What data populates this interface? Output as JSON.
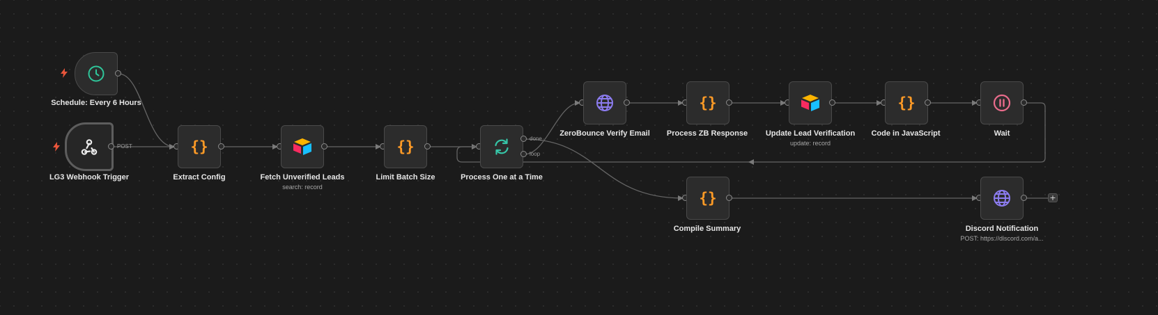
{
  "nodes": {
    "schedule": {
      "label": "Schedule: Every 6 Hours"
    },
    "webhook": {
      "label": "LG3 Webhook Trigger"
    },
    "extract_config": {
      "label": "Extract Config"
    },
    "fetch_leads": {
      "label": "Fetch Unverified Leads",
      "sublabel": "search: record"
    },
    "limit_batch": {
      "label": "Limit Batch Size"
    },
    "process_one": {
      "label": "Process One at a Time"
    },
    "zerobounce": {
      "label": "ZeroBounce Verify Email"
    },
    "process_zb": {
      "label": "Process ZB Response"
    },
    "update_lead": {
      "label": "Update Lead Verification",
      "sublabel": "update: record"
    },
    "code_js": {
      "label": "Code in JavaScript"
    },
    "wait": {
      "label": "Wait"
    },
    "compile_summary": {
      "label": "Compile Summary"
    },
    "discord": {
      "label": "Discord Notification",
      "sublabel": "POST: https://discord.com/a..."
    }
  },
  "edge_labels": {
    "post": "POST",
    "done": "done",
    "loop": "loop"
  },
  "add_button": "+",
  "colors": {
    "code": "#ff9b26",
    "http": "#8c7cf0",
    "loop": "#36c6a8",
    "schedule": "#2fc79b",
    "wait": "#ea6c8c",
    "trigger_bolt": "#e8553b",
    "edge": "#6a6a6a"
  }
}
